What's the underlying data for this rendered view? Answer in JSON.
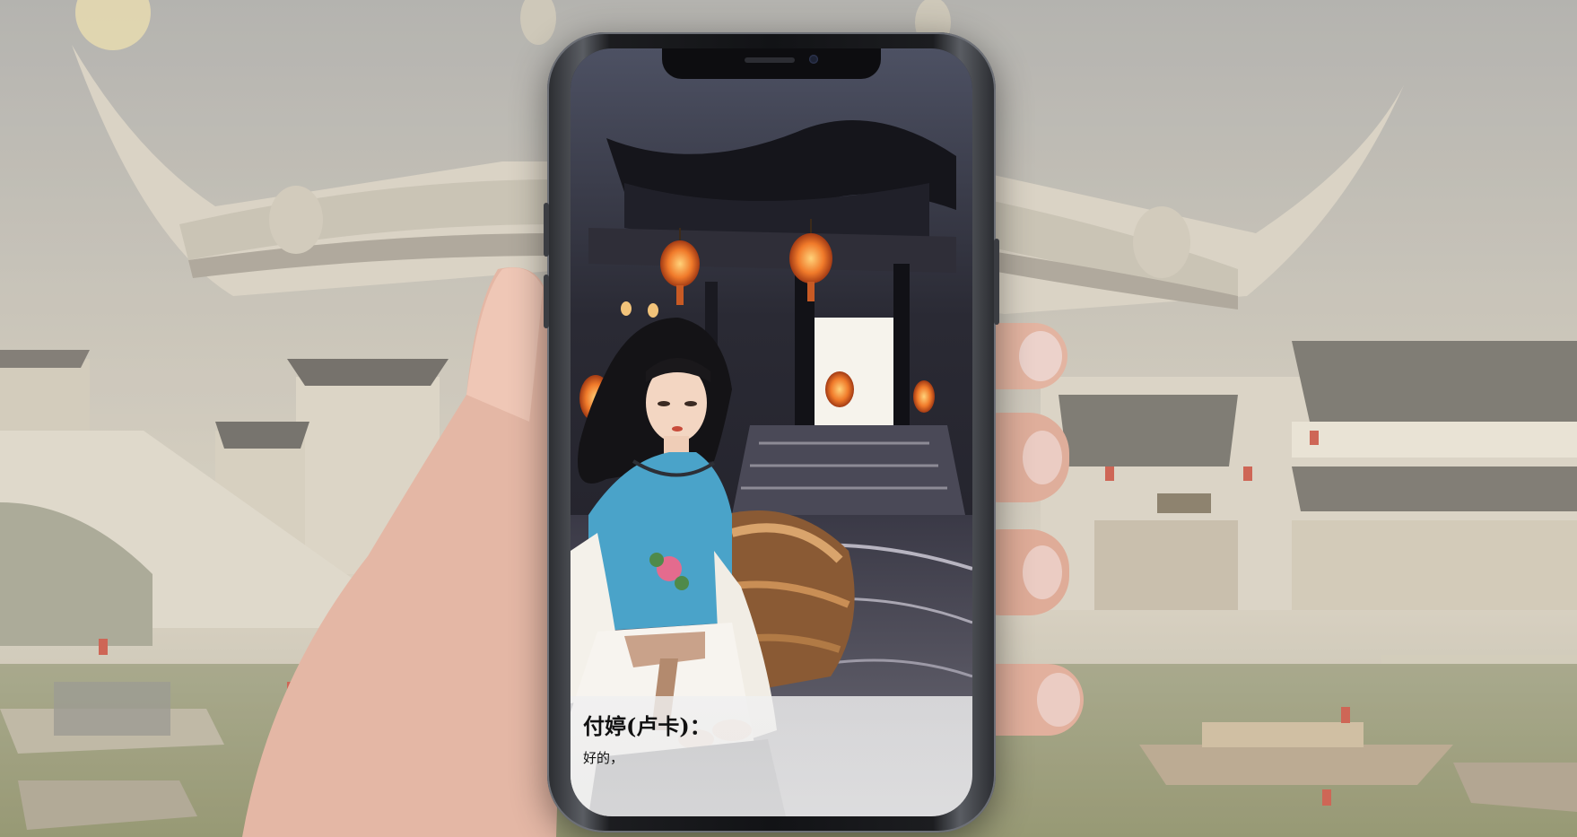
{
  "dialog": {
    "speaker": "付婷(卢卡)：",
    "text": "好的，"
  },
  "colors": {
    "dialog_bg": "#ececec",
    "lantern": "#f07a2a",
    "phone_frame": "#1c1d20",
    "sky": "#b8b6ae"
  },
  "icons": [
    "speaker-grille-icon",
    "front-camera-icon"
  ]
}
